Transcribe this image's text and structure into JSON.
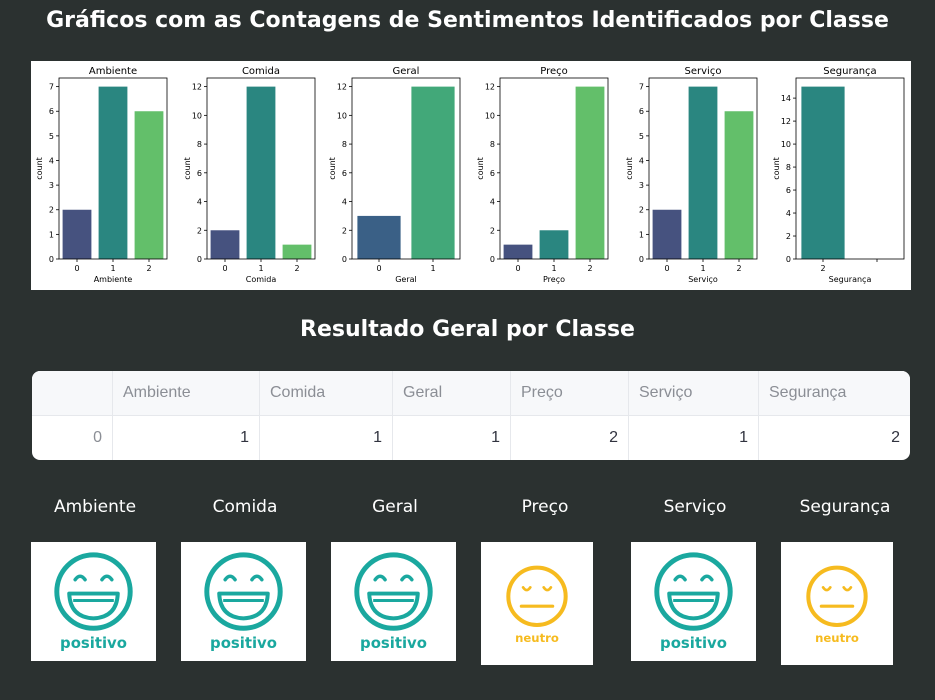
{
  "page": {
    "title": "Gráficos com as Contagens de Sentimentos Identificados por Classe",
    "subtitle": "Resultado Geral por Classe"
  },
  "chart_data": [
    {
      "type": "bar",
      "title": "Ambiente",
      "xlabel": "Ambiente",
      "ylabel": "count",
      "categories": [
        "0",
        "1",
        "2"
      ],
      "values": [
        2,
        7,
        6
      ],
      "ylim": [
        0,
        7.35
      ],
      "yticks": [
        0,
        1,
        2,
        3,
        4,
        5,
        6,
        7
      ],
      "colors": [
        "#46527f",
        "#2a8680",
        "#63bf6a"
      ]
    },
    {
      "type": "bar",
      "title": "Comida",
      "xlabel": "Comida",
      "ylabel": "count",
      "categories": [
        "0",
        "1",
        "2"
      ],
      "values": [
        2,
        12,
        1
      ],
      "ylim": [
        0,
        12.6
      ],
      "yticks": [
        0,
        2,
        4,
        6,
        8,
        10,
        12
      ],
      "colors": [
        "#46527f",
        "#2a8680",
        "#63bf6a"
      ]
    },
    {
      "type": "bar",
      "title": "Geral",
      "xlabel": "Geral",
      "ylabel": "count",
      "categories": [
        "0",
        "1"
      ],
      "values": [
        3,
        12
      ],
      "ylim": [
        0,
        12.6
      ],
      "yticks": [
        0,
        2,
        4,
        6,
        8,
        10,
        12
      ],
      "colors": [
        "#3a6086",
        "#42a879"
      ]
    },
    {
      "type": "bar",
      "title": "Preço",
      "xlabel": "Preço",
      "ylabel": "count",
      "categories": [
        "0",
        "1",
        "2"
      ],
      "values": [
        1,
        2,
        12
      ],
      "ylim": [
        0,
        12.6
      ],
      "yticks": [
        0,
        2,
        4,
        6,
        8,
        10,
        12
      ],
      "colors": [
        "#46527f",
        "#2a8680",
        "#63bf6a"
      ]
    },
    {
      "type": "bar",
      "title": "Serviço",
      "xlabel": "Serviço",
      "ylabel": "count",
      "categories": [
        "0",
        "1",
        "2"
      ],
      "values": [
        2,
        7,
        6
      ],
      "ylim": [
        0,
        7.35
      ],
      "yticks": [
        0,
        1,
        2,
        3,
        4,
        5,
        6,
        7
      ],
      "colors": [
        "#46527f",
        "#2a8680",
        "#63bf6a"
      ]
    },
    {
      "type": "bar",
      "title": "Segurança",
      "xlabel": "Segurança",
      "ylabel": "count",
      "categories": [
        "2",
        ""
      ],
      "values": [
        15,
        0
      ],
      "ylim": [
        0,
        15.75
      ],
      "yticks": [
        0,
        2,
        4,
        6,
        8,
        10,
        12,
        14
      ],
      "colors": [
        "#2a8680",
        "#2a8680"
      ]
    }
  ],
  "table": {
    "columns": [
      "",
      "Ambiente",
      "Comida",
      "Geral",
      "Preço",
      "Serviço",
      "Segurança"
    ],
    "rows": [
      [
        "0",
        "1",
        "1",
        "1",
        "2",
        "1",
        "2"
      ]
    ]
  },
  "results": [
    {
      "label": "Ambiente",
      "sentiment": "positivo",
      "color": "#1aa89f"
    },
    {
      "label": "Comida",
      "sentiment": "positivo",
      "color": "#1aa89f"
    },
    {
      "label": "Geral",
      "sentiment": "positivo",
      "color": "#1aa89f"
    },
    {
      "label": "Preço",
      "sentiment": "neutro",
      "color": "#f6bb1f"
    },
    {
      "label": "Serviço",
      "sentiment": "positivo",
      "color": "#1aa89f"
    },
    {
      "label": "Segurança",
      "sentiment": "neutro",
      "color": "#f6bb1f"
    }
  ]
}
